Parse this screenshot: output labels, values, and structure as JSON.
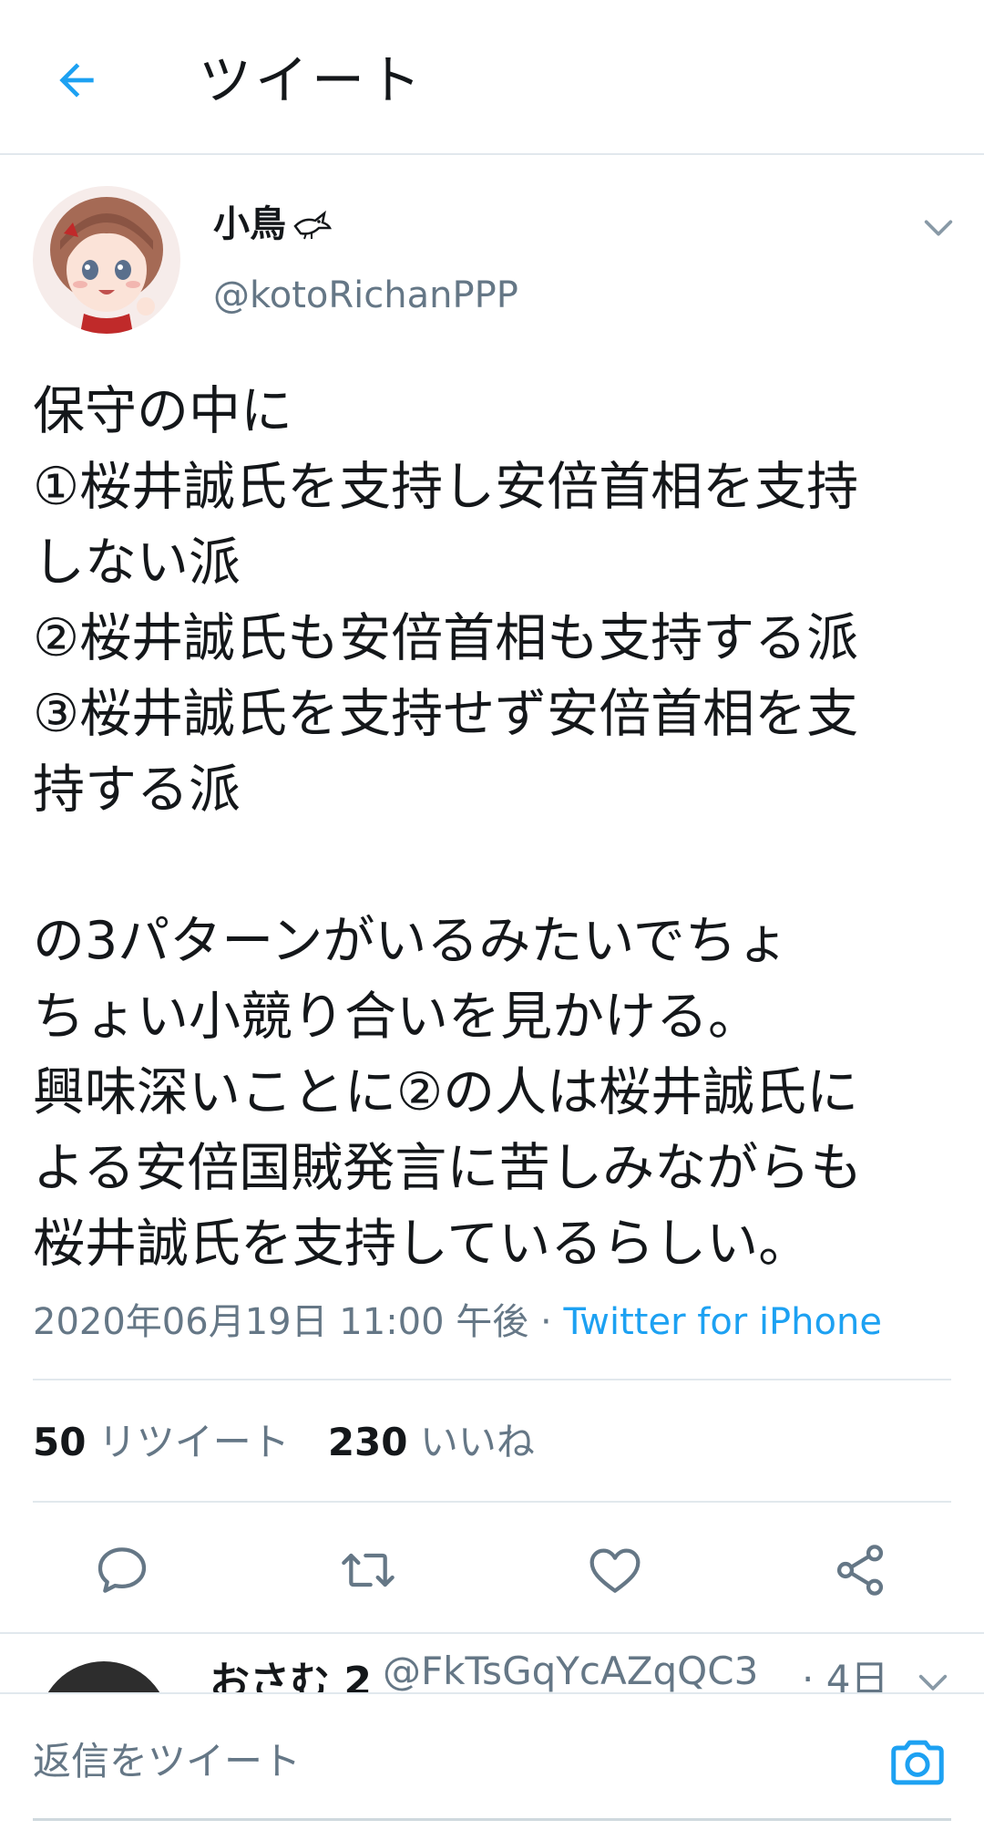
{
  "header": {
    "title": "ツイート",
    "back_icon": "arrow-left-icon"
  },
  "tweet": {
    "display_name": "小鳥",
    "handle": "@kotoRichanPPP",
    "text": "保守の中に\n①桜井誠氏を支持し安倍首相を支持\nしない派\n②桜井誠氏も安倍首相も支持する派\n③桜井誠氏を支持せず安倍首相を支\n持する派\n\nの3パターンがいるみたいでちょ\nちょい小競り合いを見かける。\n興味深いことに②の人は桜井誠氏に\nよる安倍国賊発言に苦しみながらも\n桜井誠氏を支持しているらしい。",
    "timestamp": "2020年06月19日 11:00 午後 · ",
    "source": "Twitter for iPhone",
    "retweet_count": "50",
    "retweet_label": " リツイート",
    "like_count": "230",
    "like_label": " いいね"
  },
  "actions": {
    "reply_icon": "reply-icon",
    "retweet_icon": "retweet-icon",
    "like_icon": "heart-icon",
    "share_icon": "share-icon"
  },
  "reply_preview": {
    "name": "おさむ 2",
    "handle": "@FkTsGqYcAZqQC3",
    "time": "· 4日"
  },
  "compose": {
    "placeholder": "返信をツイート",
    "camera_icon": "camera-icon"
  },
  "colors": {
    "accent": "#1da1f2",
    "text": "#14171a",
    "secondary": "#657786",
    "divider": "#e1e8ed"
  }
}
